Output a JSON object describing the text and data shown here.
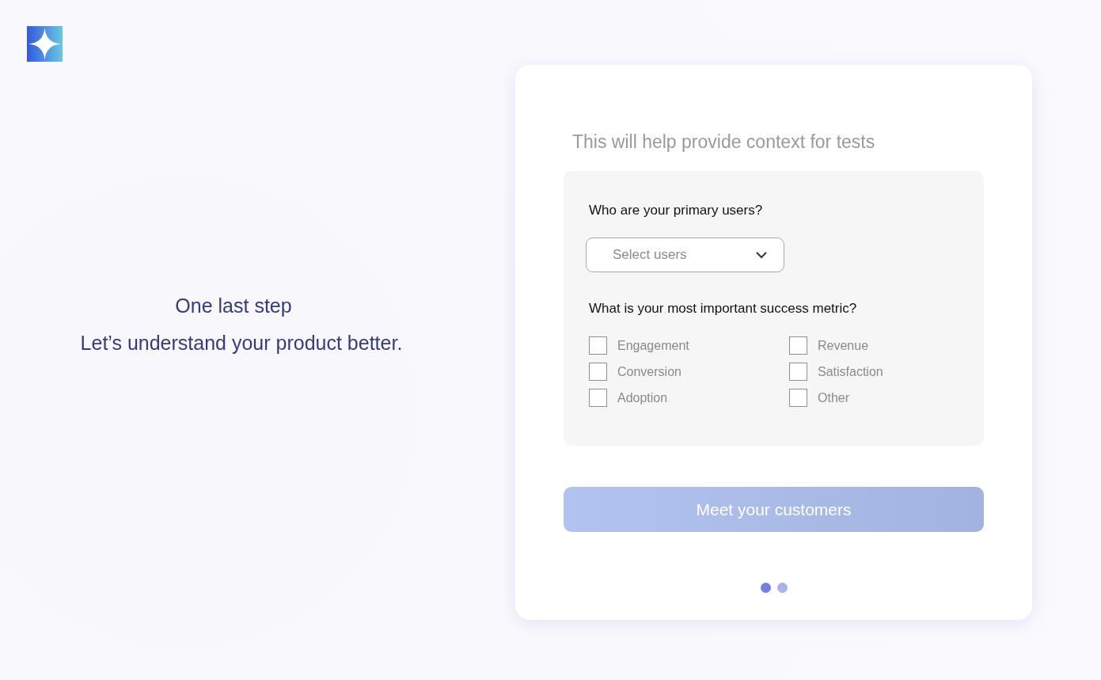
{
  "intro": {
    "title": "One last step",
    "subtitle": "Let’s understand your product better."
  },
  "card": {
    "subtitle": "This will help provide context for tests",
    "users_question": {
      "label": "Who are your primary users?",
      "placeholder": "Select users"
    },
    "metric_question": {
      "label": "What is your most important success metric?",
      "options": [
        {
          "label": "Engagement",
          "checked": false
        },
        {
          "label": "Conversion",
          "checked": false
        },
        {
          "label": "Adoption",
          "checked": false
        },
        {
          "label": "Revenue",
          "checked": false
        },
        {
          "label": "Satisfaction",
          "checked": false
        },
        {
          "label": "Other",
          "checked": false
        }
      ]
    },
    "button": {
      "label": "Meet your customers",
      "disabled": true
    },
    "steps": [
      {
        "selected": true
      },
      {
        "selected": false
      }
    ]
  }
}
